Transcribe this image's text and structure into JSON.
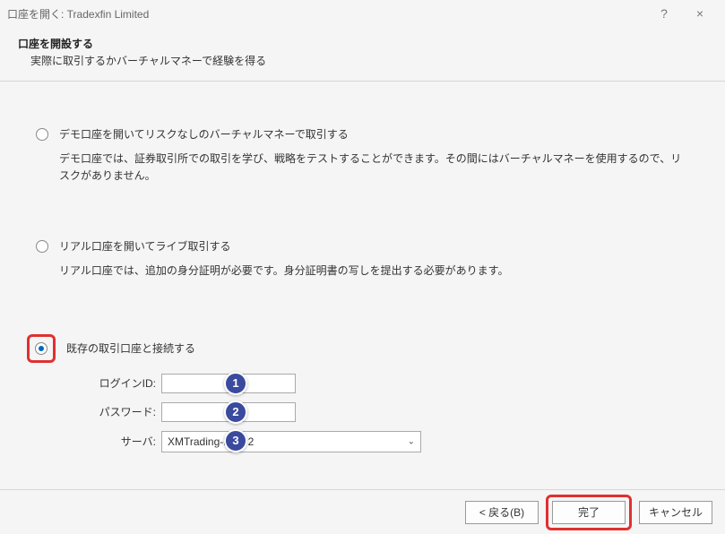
{
  "titlebar": {
    "text": "口座を開く: Tradexfin Limited",
    "help": "?",
    "close": "×"
  },
  "header": {
    "title": "口座を開設する",
    "subtitle": "実際に取引するかバーチャルマネーで経験を得る"
  },
  "options": {
    "demo": {
      "label": "デモ口座を開いてリスクなしのバーチャルマネーで取引する",
      "desc": "デモ口座では、証券取引所での取引を学び、戦略をテストすることができます。その間にはバーチャルマネーを使用するので、リスクがありません。"
    },
    "real": {
      "label": "リアル口座を開いてライブ取引する",
      "desc": "リアル口座では、追加の身分証明が必要です。身分証明書の写しを提出する必要があります。"
    },
    "existing": {
      "label": "既存の取引口座と接続する"
    }
  },
  "form": {
    "login_label": "ログインID:",
    "login_value": "",
    "password_label": "パスワード:",
    "password_value": "",
    "server_label": "サーバ:",
    "server_value": "XMTrading-MT5 2"
  },
  "annotations": {
    "badge1": "1",
    "badge2": "2",
    "badge3": "3"
  },
  "footer": {
    "back": "< 戻る(B)",
    "finish": "完了",
    "cancel": "キャンセル"
  }
}
